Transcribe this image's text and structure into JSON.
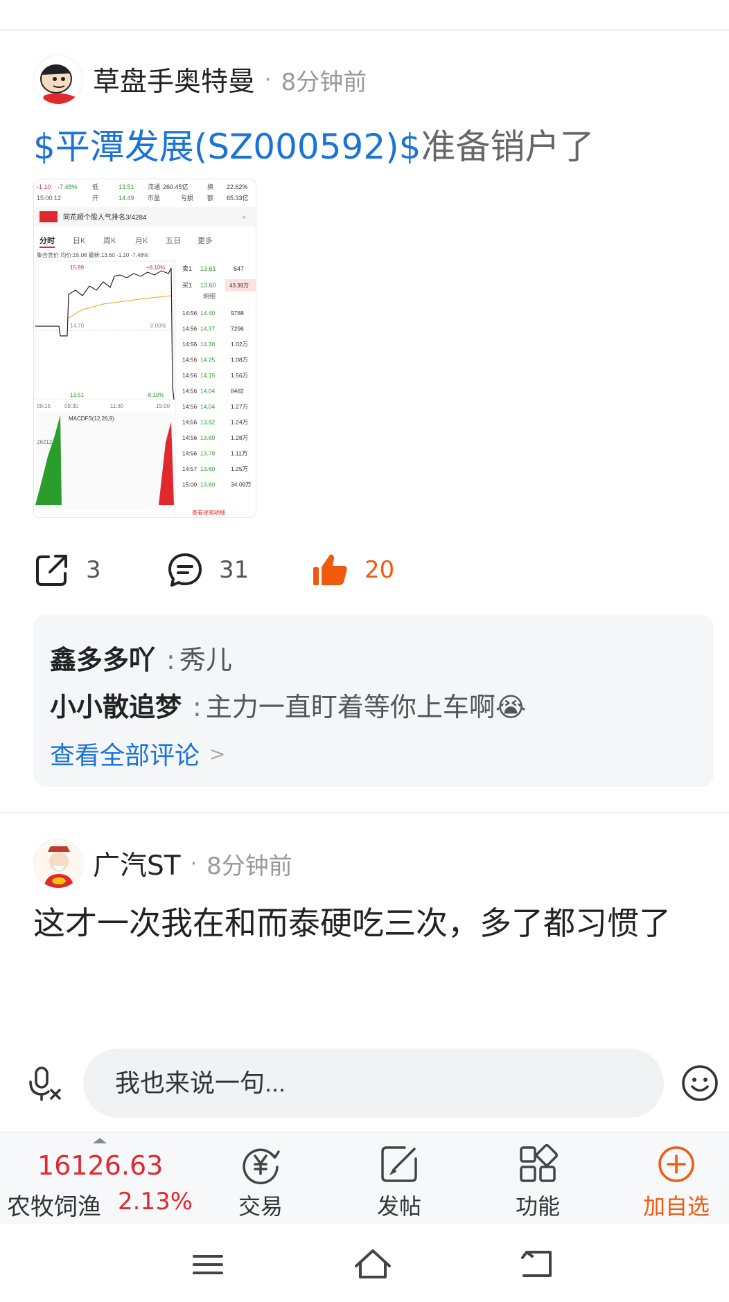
{
  "post1": {
    "username": "草盘手奥特曼",
    "time": "8分钟前",
    "title_tag": "$平潭发展(SZ000592)$",
    "title_rest": "准备销户了",
    "actions": {
      "shares": "3",
      "comments": "31",
      "likes": "20"
    },
    "comments": [
      {
        "name": "鑫多多吖",
        "text": "秀儿"
      },
      {
        "name": "小小散追梦",
        "text": "主力一直盯着等你上车啊😭"
      }
    ],
    "view_all": "查看全部评论"
  },
  "post2": {
    "username": "广汽ST",
    "time": "8分钟前",
    "text": "这才一次我在和而泰硬吃三次，多了都习惯了"
  },
  "reply": {
    "placeholder": "我也来说一句..."
  },
  "toolbar": {
    "index_value": "16126.63",
    "index_name": "农牧饲渔",
    "index_change": "2.13%",
    "trade": "交易",
    "post": "发帖",
    "functions": "功能",
    "add_watch": "加自选"
  },
  "colors": {
    "link": "#1a73d9",
    "accent": "#f15a0d",
    "rise": "#e0292e"
  },
  "chart_thumbnail": {
    "header": {
      "low": "13.51",
      "float": "260.45亿",
      "turnover": "22.62%",
      "open": "14.49",
      "pe": "亏损",
      "amount": "65.33亿",
      "chg": "-1.10",
      "pct": "-7.48%",
      "time": "15:00:12"
    },
    "rank_banner": "同花顺个股人气排名3/4284",
    "tabs": [
      "分时",
      "日K",
      "周K",
      "月K",
      "五日",
      "更多"
    ],
    "auction_line": "集合竞价  均价:15.08  最新:13.60  -1.10  -7.48%",
    "price_labels": {
      "high": "15.89",
      "mid": "14.70",
      "low": "13.51",
      "pct_high": "+8.10%",
      "pct_mid": "0.00%",
      "pct_low": "-8.10%"
    },
    "time_axis": [
      "09:15",
      "09:30",
      "11:30",
      "15:00"
    ],
    "macd_label": "MACDFS(12,26,9)",
    "vol_label": "26212",
    "orderbook": [
      {
        "side": "卖1",
        "price": "13.61",
        "vol": "647"
      },
      {
        "side": "买1",
        "price": "13.60",
        "vol": "43.39万"
      }
    ],
    "detail_label": "明细",
    "ticks": [
      [
        "14:56",
        "14.40",
        "9788"
      ],
      [
        "14:56",
        "14.37",
        "7296"
      ],
      [
        "14:56",
        "14.30",
        "1.02万"
      ],
      [
        "14:56",
        "14.25",
        "1.08万"
      ],
      [
        "14:56",
        "14.15",
        "1.56万"
      ],
      [
        "14:56",
        "14.04",
        "8482"
      ],
      [
        "14:56",
        "14.04",
        "1.27万"
      ],
      [
        "14:56",
        "13.92",
        "1.24万"
      ],
      [
        "14:56",
        "13.89",
        "1.28万"
      ],
      [
        "14:56",
        "13.79",
        "1.11万"
      ],
      [
        "14:57",
        "13.60",
        "1.25万"
      ],
      [
        "15:00",
        "13.60",
        "34.09万"
      ]
    ],
    "more_detail": "查看逐笔明细"
  }
}
